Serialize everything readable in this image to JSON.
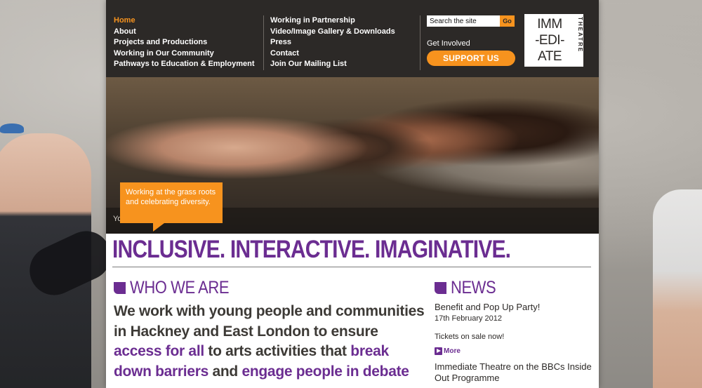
{
  "nav": {
    "col1": [
      "Home",
      "About",
      "Projects and Productions",
      "Working in Our Community",
      "Pathways to Education & Employment"
    ],
    "col2": [
      "Working in Partnership",
      "Video/Image Gallery & Downloads",
      "Press",
      "Contact",
      "Join Our Mailing List"
    ]
  },
  "search": {
    "placeholder": "Search the site",
    "go_label": "Go"
  },
  "get_involved": "Get Involved",
  "support_button": "SUPPORT US",
  "logo": {
    "lines": [
      "IMM",
      "-EDI-",
      "ATE"
    ],
    "vertical": "THEATRE"
  },
  "hero": {
    "callout": "Working at the grass roots and celebrating diversity.",
    "caption": "Young..."
  },
  "tagline": "INCLUSIVE. INTERACTIVE. IMAGINATIVE.",
  "who_we_are": {
    "title": "WHO WE ARE",
    "text_1": "We work with young people and communities in Hackney and East London to ensure ",
    "link_1": "access for all",
    "text_2": " to arts activities that ",
    "link_2": "break down barriers",
    "text_3": " and ",
    "link_3": "engage people in",
    "text_4": " debate"
  },
  "news": {
    "title": "NEWS",
    "items": [
      {
        "title": "Benefit and Pop Up Party!",
        "date": "17th February 2012",
        "body": "Tickets on sale now!",
        "more": "More"
      },
      {
        "title": "Immediate Theatre on the BBCs Inside Out Programme"
      }
    ]
  },
  "colors": {
    "purple": "#6b2d91",
    "orange": "#f7931e",
    "header": "#2c2927"
  }
}
